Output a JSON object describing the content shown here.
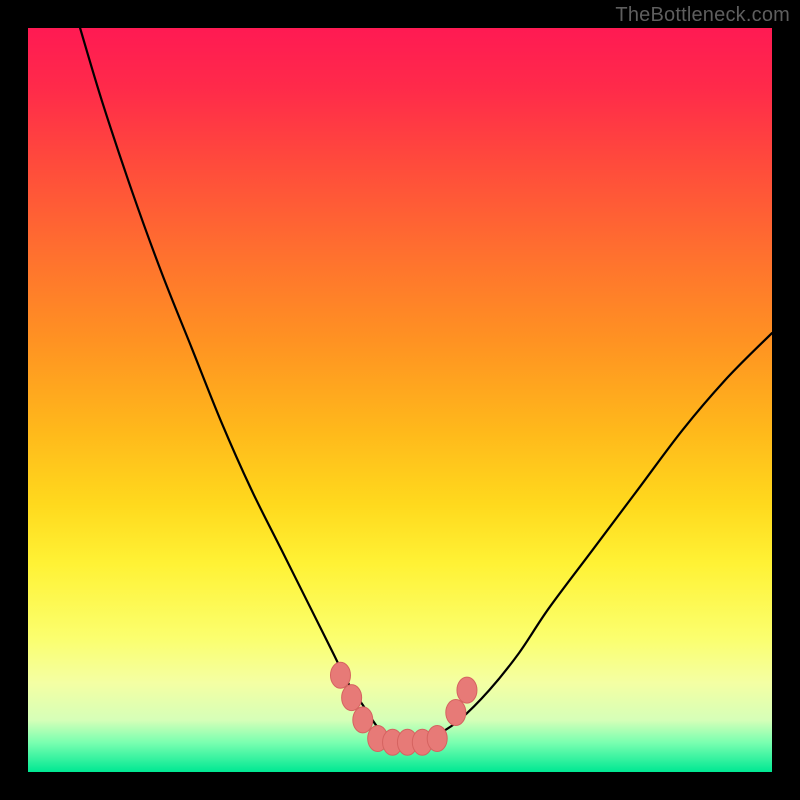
{
  "watermark": "TheBottleneck.com",
  "colors": {
    "curve_stroke": "#000000",
    "marker_fill": "#e77a77",
    "marker_stroke": "#d56360"
  },
  "chart_data": {
    "type": "line",
    "title": "",
    "xlabel": "",
    "ylabel": "",
    "xlim": [
      0,
      100
    ],
    "ylim": [
      0,
      100
    ],
    "grid": false,
    "legend": false,
    "series": [
      {
        "name": "bottleneck-curve",
        "x": [
          7,
          10,
          14,
          18,
          22,
          26,
          30,
          34,
          38,
          41,
          43,
          45,
          47,
          49,
          51,
          53,
          55,
          58,
          62,
          66,
          70,
          76,
          82,
          88,
          94,
          100
        ],
        "y": [
          100,
          90,
          78,
          67,
          57,
          47,
          38,
          30,
          22,
          16,
          12,
          9,
          6,
          4,
          4,
          4,
          5,
          7,
          11,
          16,
          22,
          30,
          38,
          46,
          53,
          59
        ]
      }
    ],
    "markers": [
      {
        "x": 42,
        "y": 13
      },
      {
        "x": 43.5,
        "y": 10
      },
      {
        "x": 45,
        "y": 7
      },
      {
        "x": 47,
        "y": 4.5
      },
      {
        "x": 49,
        "y": 4
      },
      {
        "x": 51,
        "y": 4
      },
      {
        "x": 53,
        "y": 4
      },
      {
        "x": 55,
        "y": 4.5
      },
      {
        "x": 57.5,
        "y": 8
      },
      {
        "x": 59,
        "y": 11
      }
    ]
  }
}
